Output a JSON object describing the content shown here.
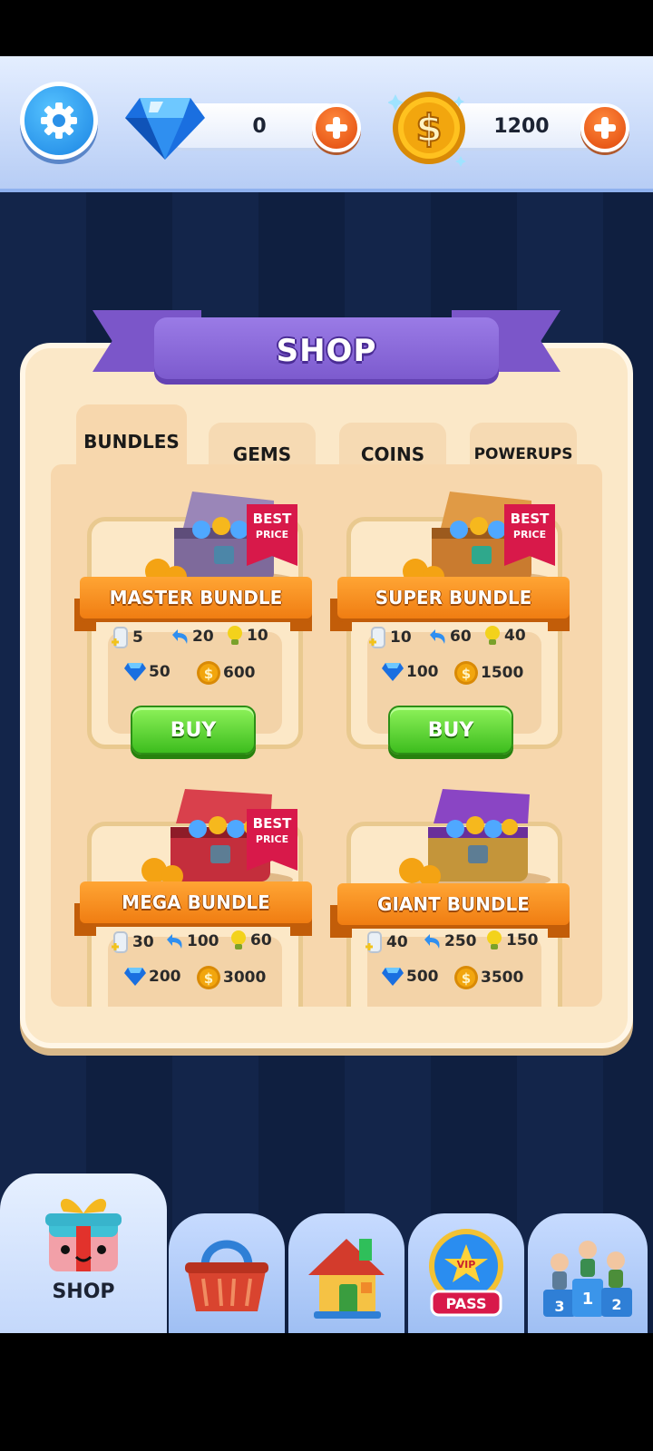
{
  "currency": {
    "gems": "0",
    "coins": "1200"
  },
  "shop": {
    "title": "SHOP",
    "tabs": [
      "BUNDLES",
      "GEMS",
      "COINS",
      "POWERUPS"
    ],
    "badge_line1": "BEST",
    "badge_line2": "PRICE",
    "buy_label": "BUY",
    "bundles": [
      {
        "name": "MASTER BUNDLE",
        "tickets": "5",
        "undo": "20",
        "hints": "10",
        "gems": "50",
        "coins": "600"
      },
      {
        "name": "SUPER BUNDLE",
        "tickets": "10",
        "undo": "60",
        "hints": "40",
        "gems": "100",
        "coins": "1500"
      },
      {
        "name": "MEGA BUNDLE",
        "tickets": "30",
        "undo": "100",
        "hints": "60",
        "gems": "200",
        "coins": "3000"
      },
      {
        "name": "GIANT BUNDLE",
        "tickets": "40",
        "undo": "250",
        "hints": "150",
        "gems": "500",
        "coins": "3500"
      }
    ]
  },
  "nav": {
    "shop_label": "SHOP",
    "vip_line1": "VIP",
    "vip_line2": "PASS",
    "podium": [
      "3",
      "1",
      "2"
    ]
  },
  "colors": {
    "accent_purple": "#7a58cc",
    "accent_orange": "#f07d12",
    "buy_green": "#3dbd1e",
    "badge_red": "#d8194a"
  }
}
